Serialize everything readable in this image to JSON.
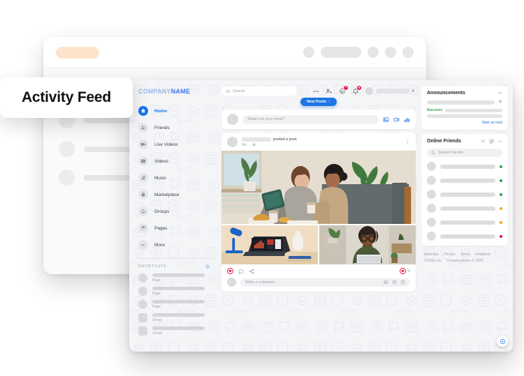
{
  "label_chip": {
    "text": "Activity Feed"
  },
  "brand": {
    "part1": "COMPANY",
    "part2": "NAME"
  },
  "sidebar": {
    "items": [
      {
        "label": "Home",
        "icon": "home-icon",
        "active": true
      },
      {
        "label": "Friends",
        "icon": "friends-icon",
        "active": false
      },
      {
        "label": "Live Videos",
        "icon": "live-video-icon",
        "active": false
      },
      {
        "label": "Videos",
        "icon": "video-icon",
        "active": false
      },
      {
        "label": "Music",
        "icon": "music-icon",
        "active": false
      },
      {
        "label": "Marketplace",
        "icon": "marketplace-bag-icon",
        "active": false
      },
      {
        "label": "Groups",
        "icon": "groups-icon",
        "active": false
      },
      {
        "label": "Pages",
        "icon": "pages-flag-icon",
        "active": false
      },
      {
        "label": "More",
        "icon": "chevron-down-icon",
        "active": false
      }
    ],
    "shortcuts_title": "SHORTCUTS",
    "shortcuts": [
      {
        "sub": "Page",
        "shape": "circle"
      },
      {
        "sub": "Page",
        "shape": "circle"
      },
      {
        "sub": "Page",
        "shape": "circle"
      },
      {
        "sub": "Group",
        "shape": "square"
      },
      {
        "sub": "Group",
        "shape": "square"
      }
    ]
  },
  "topbar": {
    "search_placeholder": "Search",
    "messages_badge": "7",
    "notifications_badge": "6",
    "new_posts_label": "New Posts",
    "new_posts_arrow": "↑"
  },
  "composer": {
    "placeholder": "What's on your mind?"
  },
  "post": {
    "action_text": "posted a post.",
    "time": "5m",
    "privacy_icon": "globe-icon",
    "reaction_count": "1",
    "comment_placeholder": "Write a comment...",
    "media": [
      {
        "name": "couple-on-sofa-with-tablet"
      },
      {
        "name": "laptop-dashboard-on-desk"
      },
      {
        "name": "man-with-laptop"
      }
    ]
  },
  "announcements": {
    "title": "Announcements",
    "status_label": "Success",
    "mark_as_read": "Mark as read"
  },
  "online_friends": {
    "title": "Online Friends",
    "search_placeholder": "Search friends",
    "rows": [
      {
        "status_color": "#31a24c"
      },
      {
        "status_color": "#31a24c"
      },
      {
        "status_color": "#31a24c"
      },
      {
        "status_color": "#f5a623"
      },
      {
        "status_color": "#f5a623"
      },
      {
        "status_color": "#e4103a"
      }
    ]
  },
  "footer": {
    "links": [
      "Advertise",
      "Privacy",
      "Terms",
      "Invitations"
    ],
    "links2": [
      "Contact Us"
    ],
    "copyright": "CompanyName © 2023"
  },
  "colors": {
    "brand_blue": "#2076e2",
    "badge_red": "#e4103a",
    "success_green": "#2e9e4f",
    "chip_orange": "#fde3cc"
  }
}
